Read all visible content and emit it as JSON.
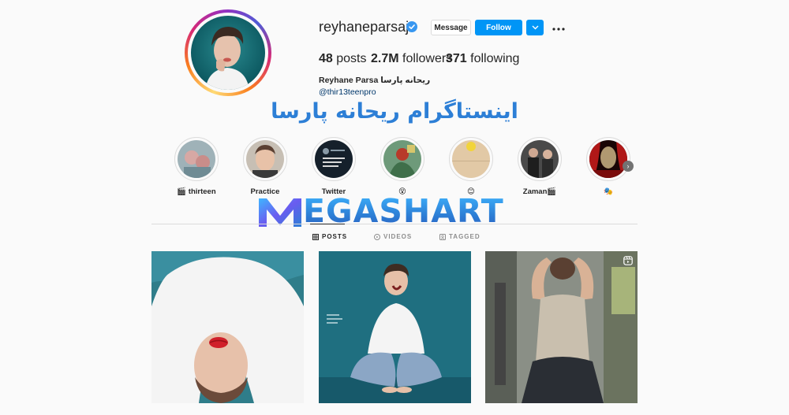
{
  "profile": {
    "username": "reyhaneparsaj",
    "full_name": "Reyhane Parsa ریحانه پارسا",
    "link": "@thir13teenpro",
    "verified": true
  },
  "actions": {
    "message_label": "Message",
    "follow_label": "Follow",
    "dropdown_icon": "chevron-down-icon",
    "more_icon": "more-horizontal-icon"
  },
  "stats": {
    "posts_count": "48",
    "posts_label": "posts",
    "followers_count": "2.7M",
    "followers_label": "followers",
    "following_count": "371",
    "following_label": "following"
  },
  "overlay": {
    "persian_title": "اینستاگرام ریحانه پارسا",
    "watermark_text": "EGASHART"
  },
  "highlights": [
    {
      "label": "🎬 thirteen"
    },
    {
      "label": "Practice"
    },
    {
      "label": "Twitter"
    },
    {
      "label": "😵"
    },
    {
      "label": "😊"
    },
    {
      "label": "Zaman🎬"
    },
    {
      "label": "🎭"
    }
  ],
  "tabs": [
    {
      "label": "POSTS",
      "active": true,
      "icon": "grid-icon"
    },
    {
      "label": "VIDEOS",
      "active": false,
      "icon": "video-icon"
    },
    {
      "label": "TAGGED",
      "active": false,
      "icon": "tag-icon"
    }
  ],
  "colors": {
    "accent": "#0095f6",
    "watermark_blue": "#2d7fd6",
    "link": "#00376b"
  }
}
